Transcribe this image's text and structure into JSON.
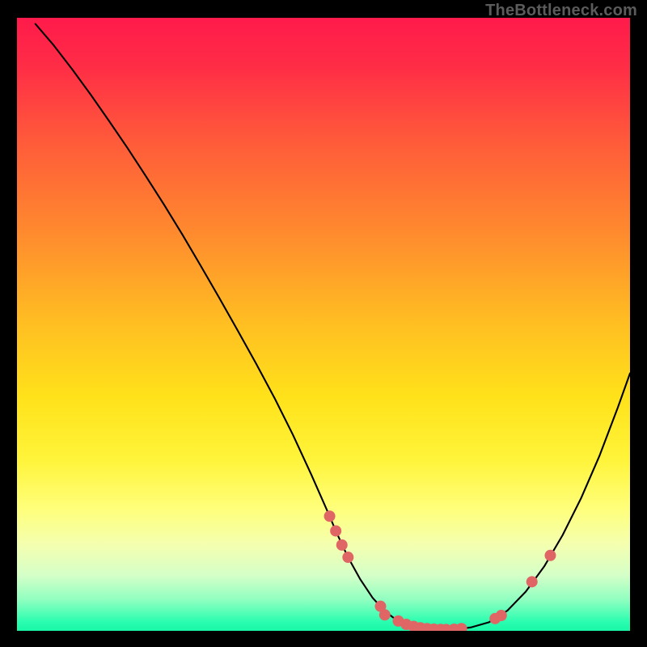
{
  "attribution": "TheBottleneck.com",
  "chart_data": {
    "type": "line",
    "title": "",
    "xlabel": "",
    "ylabel": "",
    "xlim": [
      0,
      100
    ],
    "ylim": [
      0,
      100
    ],
    "grid": false,
    "legend": "none",
    "background": {
      "type": "vertical-gradient",
      "stops": [
        {
          "offset": 0.0,
          "color": "#ff1a4b"
        },
        {
          "offset": 0.08,
          "color": "#ff2d46"
        },
        {
          "offset": 0.2,
          "color": "#ff5a3a"
        },
        {
          "offset": 0.35,
          "color": "#ff8a2e"
        },
        {
          "offset": 0.5,
          "color": "#ffbf22"
        },
        {
          "offset": 0.62,
          "color": "#ffe21a"
        },
        {
          "offset": 0.72,
          "color": "#fff43a"
        },
        {
          "offset": 0.8,
          "color": "#ffff7a"
        },
        {
          "offset": 0.86,
          "color": "#f4ffb0"
        },
        {
          "offset": 0.91,
          "color": "#d4ffc8"
        },
        {
          "offset": 0.95,
          "color": "#8effc0"
        },
        {
          "offset": 0.985,
          "color": "#2bfdb0"
        },
        {
          "offset": 1.0,
          "color": "#18f7a7"
        }
      ]
    },
    "series": [
      {
        "name": "bottleneck-curve",
        "color": "#000000",
        "width": 2.1,
        "x": [
          3.0,
          6.0,
          9.0,
          12.0,
          15.0,
          18.0,
          21.0,
          24.0,
          27.0,
          30.0,
          33.0,
          36.0,
          39.0,
          42.0,
          45.0,
          48.0,
          51.0,
          52.0,
          54.0,
          56.0,
          58.0,
          60.0,
          62.0,
          64.0,
          67.0,
          70.0,
          72.0,
          74.0,
          77.0,
          80.0,
          83.0,
          86.0,
          89.0,
          92.0,
          95.0,
          98.0,
          100.0
        ],
        "y": [
          99.0,
          95.5,
          91.6,
          87.5,
          83.2,
          78.8,
          74.2,
          69.5,
          64.6,
          59.5,
          54.3,
          49.0,
          43.6,
          38.0,
          32.0,
          25.5,
          18.7,
          16.3,
          12.0,
          8.4,
          5.4,
          3.2,
          1.7,
          0.9,
          0.35,
          0.22,
          0.3,
          0.55,
          1.4,
          3.3,
          6.4,
          10.5,
          15.6,
          21.6,
          28.5,
          36.4,
          42.0
        ]
      }
    ],
    "markers": {
      "name": "highlight-dots",
      "color": "#e06666",
      "radius": 7,
      "points": [
        {
          "x": 51.0,
          "y": 18.7
        },
        {
          "x": 52.0,
          "y": 16.3
        },
        {
          "x": 53.0,
          "y": 14.0
        },
        {
          "x": 54.0,
          "y": 12.0
        },
        {
          "x": 59.3,
          "y": 4.0
        },
        {
          "x": 60.0,
          "y": 2.6
        },
        {
          "x": 62.2,
          "y": 1.6
        },
        {
          "x": 63.5,
          "y": 1.05
        },
        {
          "x": 64.7,
          "y": 0.72
        },
        {
          "x": 65.8,
          "y": 0.5
        },
        {
          "x": 66.9,
          "y": 0.37
        },
        {
          "x": 68.0,
          "y": 0.28
        },
        {
          "x": 69.1,
          "y": 0.23
        },
        {
          "x": 70.0,
          "y": 0.22
        },
        {
          "x": 71.3,
          "y": 0.27
        },
        {
          "x": 72.5,
          "y": 0.37
        },
        {
          "x": 78.0,
          "y": 2.0
        },
        {
          "x": 79.0,
          "y": 2.5
        },
        {
          "x": 84.0,
          "y": 8.0
        },
        {
          "x": 87.0,
          "y": 12.3
        }
      ]
    }
  }
}
